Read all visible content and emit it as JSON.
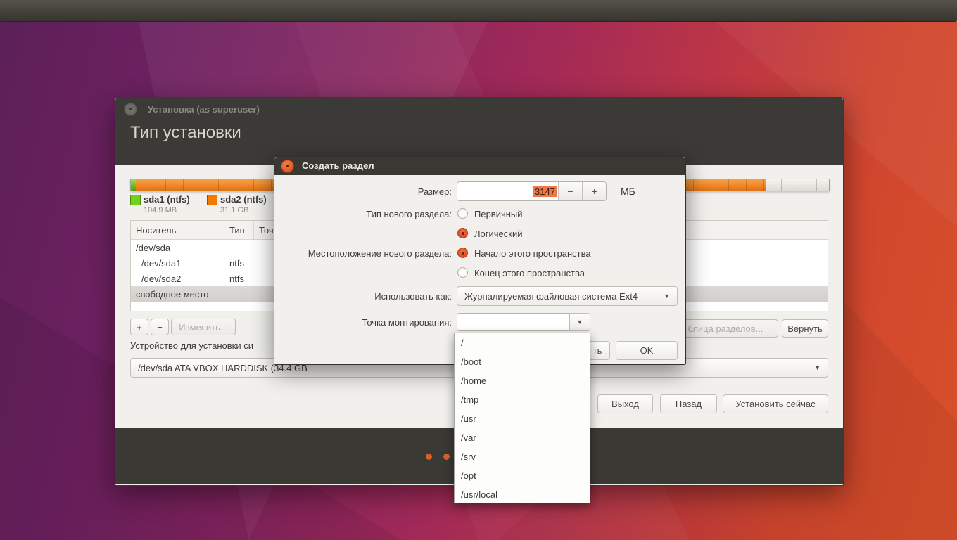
{
  "main_window": {
    "title": "Установка (as superuser)",
    "page_title": "Тип установки",
    "legend": [
      {
        "label": "sda1 (ntfs)",
        "size": "104.9 MB",
        "color": "#73d216"
      },
      {
        "label": "sda2 (ntfs)",
        "size": "31.1 GB",
        "color": "#f57900"
      }
    ],
    "table": {
      "columns": [
        "Носитель",
        "Тип",
        "Точ"
      ],
      "rows": [
        {
          "device": "/dev/sda",
          "type": ""
        },
        {
          "device": "/dev/sda1",
          "type": "ntfs"
        },
        {
          "device": "/dev/sda2",
          "type": "ntfs"
        },
        {
          "device": "свободное место",
          "type": ""
        }
      ]
    },
    "toolbar": {
      "add": "+",
      "remove": "−",
      "change": "Изменить...",
      "new_table_fragment": "блица разделов...",
      "revert": "Вернуть"
    },
    "boot_device": {
      "label": "Устройство для установки си",
      "value": "/dev/sda   ATA VBOX HARDDISK (34.4 GB"
    },
    "footer_buttons": {
      "quit": "Выход",
      "back": "Назад",
      "install": "Установить сейчас"
    }
  },
  "dialog": {
    "title": "Создать раздел",
    "size": {
      "label": "Размер:",
      "value": "3147",
      "unit": "МБ",
      "minus": "−",
      "plus": "+"
    },
    "type": {
      "label": "Тип нового раздела:",
      "options": [
        {
          "label": "Первичный",
          "selected": false
        },
        {
          "label": "Логический",
          "selected": true
        }
      ]
    },
    "location": {
      "label": "Местоположение нового раздела:",
      "options": [
        {
          "label": "Начало этого пространства",
          "selected": true
        },
        {
          "label": "Конец этого пространства",
          "selected": false
        }
      ]
    },
    "use_as": {
      "label": "Использовать как:",
      "value": "Журналируемая файловая система Ext4"
    },
    "mount_point": {
      "label": "Точка монтирования:",
      "value": ""
    },
    "buttons": {
      "cancel_fragment": "ть",
      "ok": "OK"
    }
  },
  "mount_dropdown": {
    "items": [
      "/",
      "/boot",
      "/home",
      "/tmp",
      "/usr",
      "/var",
      "/srv",
      "/opt",
      "/usr/local"
    ]
  },
  "colors": {
    "accent_orange": "#e95420",
    "selection_highlight": "#ef7748",
    "bar_orange": "#ef8527",
    "bar_green": "#64c013",
    "progress_dot": "#dd5f2e"
  }
}
